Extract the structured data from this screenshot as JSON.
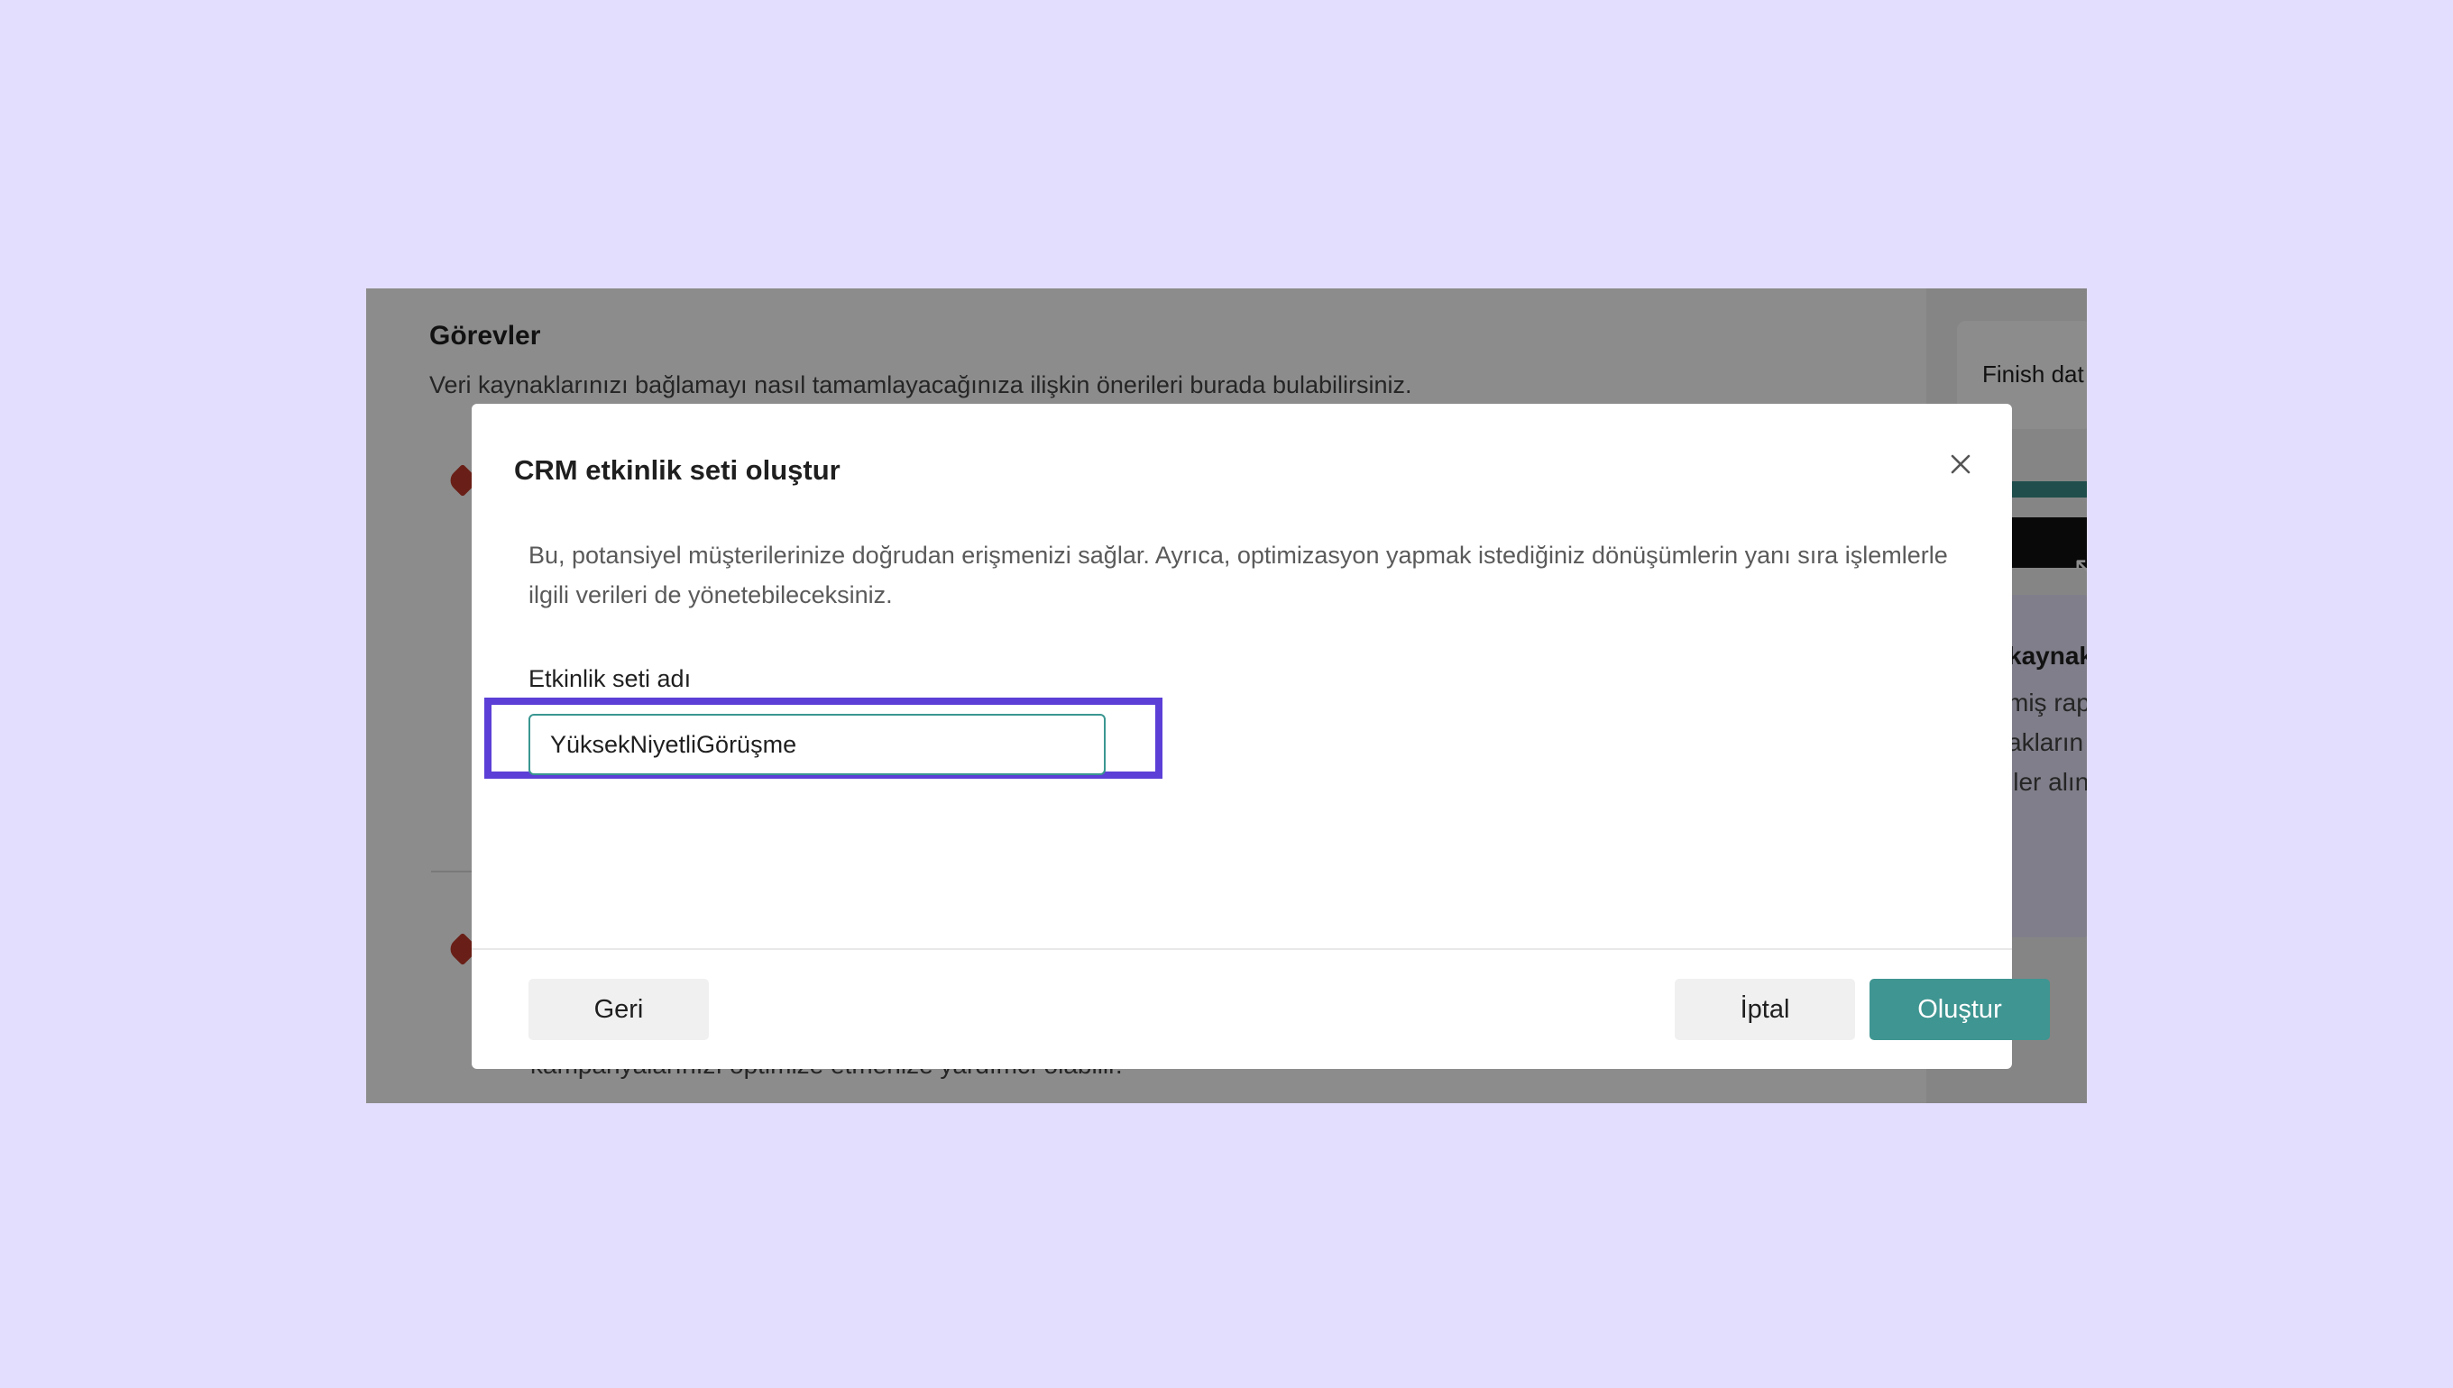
{
  "background": {
    "title": "Görevler",
    "subtitle": "Veri kaynaklarınızı bağlamayı nasıl tamamlayacağınıza ilişkin önerileri burada bulabilirsiniz.",
    "footer_text": "kampanyalarınızı optimize etmenize yardımcı olabilir.",
    "right_card_text": "Finish dat",
    "right_heading": "kaynak",
    "right_line1": "miş rap",
    "right_line2": "akların",
    "right_line3": "iler alın"
  },
  "modal": {
    "title": "CRM etkinlik seti oluştur",
    "description": "Bu, potansiyel müşterilerinize doğrudan erişmenizi sağlar. Ayrıca, optimizasyon yapmak istediğiniz dönüşümlerin yanı sıra işlemlerle ilgili verileri de yönetebileceksiniz.",
    "field_label": "Etkinlik seti adı",
    "field_value": "YüksekNiyetliGörüşme",
    "buttons": {
      "back": "Geri",
      "cancel": "İptal",
      "create": "Oluştur"
    }
  },
  "colors": {
    "page_background": "#e3defe",
    "accent_teal": "#3f9591",
    "highlight_purple": "#5b3fd6"
  }
}
